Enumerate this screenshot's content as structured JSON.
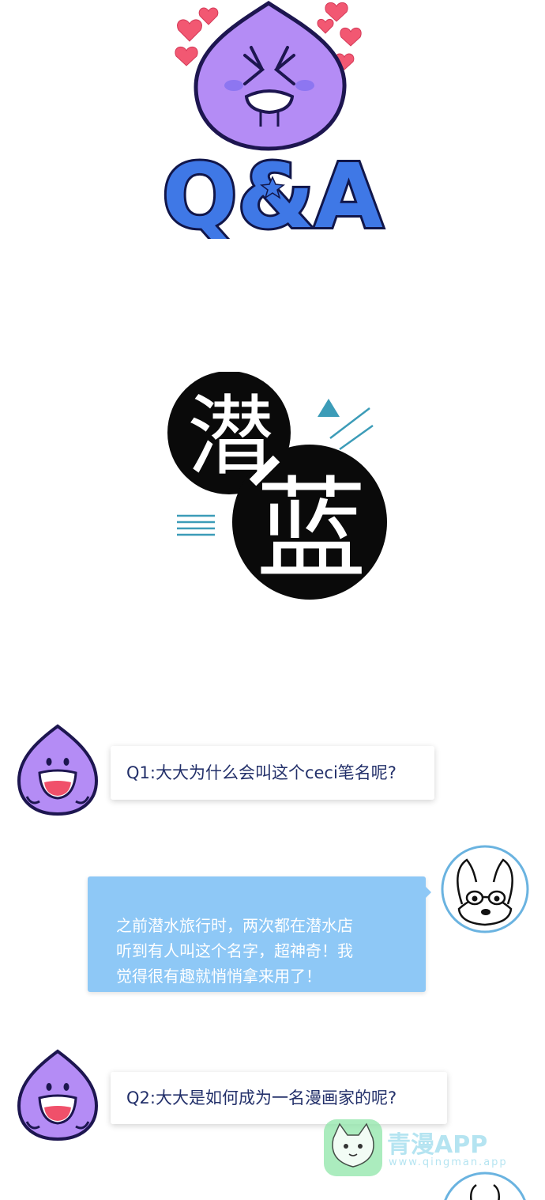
{
  "header": {
    "logo_text": "Q&A"
  },
  "title_art": {
    "char_top": "潜",
    "char_bottom": "蓝"
  },
  "conversation": [
    {
      "role": "question",
      "text": "Q1:大大为什么会叫这个ceci笔名呢?"
    },
    {
      "role": "answer",
      "text": "之前潜水旅行时，两次都在潜水店\n听到有人叫这个名字，超神奇！我\n觉得很有趣就悄悄拿来用了！"
    },
    {
      "role": "question",
      "text": "Q2:大大是如何成为一名漫画家的呢?"
    }
  ],
  "watermark": {
    "brand": "青漫APP",
    "url": "www.qingman.app"
  },
  "colors": {
    "mascot_purple": "#b48cf5",
    "logo_blue": "#3f78e6",
    "answer_bubble": "#8ec8f6",
    "question_text": "#23306a",
    "accent_teal": "#3c9cb8",
    "heart_red": "#f0506a"
  }
}
